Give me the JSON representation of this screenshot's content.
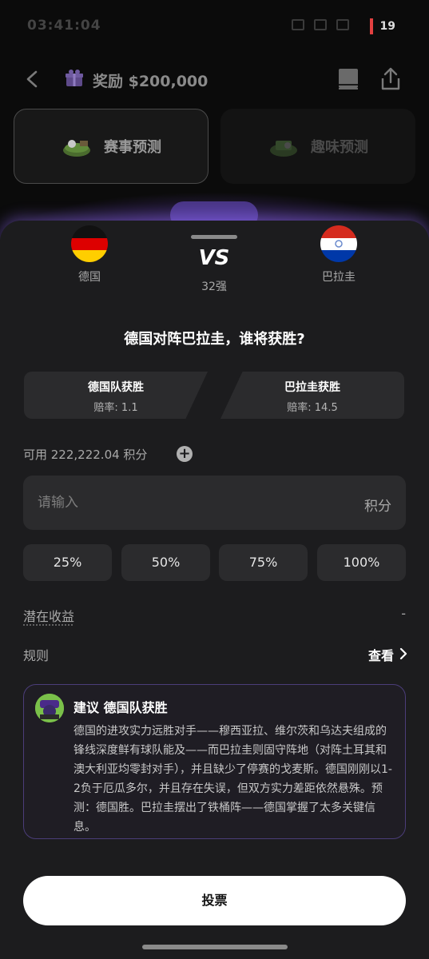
{
  "status_bar": {
    "time": "03:41:04",
    "battery": "19"
  },
  "header": {
    "title": "奖励 $200,000"
  },
  "mode_tabs": [
    {
      "label": "赛事预测",
      "active": true
    },
    {
      "label": "趣味预测",
      "active": false
    }
  ],
  "match": {
    "home": {
      "name": "德国",
      "flag": "germany-flag-icon"
    },
    "away": {
      "name": "巴拉圭",
      "flag": "paraguay-flag-icon"
    },
    "vs": "VS",
    "round": "32强",
    "question": "德国对阵巴拉圭，谁将获胜?"
  },
  "picks": [
    {
      "title": "德国队获胜",
      "odds": "赔率: 1.1"
    },
    {
      "title": "巴拉圭获胜",
      "odds": "赔率: 14.5"
    }
  ],
  "balance": {
    "label": "可用 222,222.04 积分"
  },
  "amount": {
    "placeholder": "请输入",
    "unit": "积分"
  },
  "percent_options": [
    "25%",
    "50%",
    "75%",
    "100%"
  ],
  "potential": {
    "label": "潜在收益",
    "value": "-"
  },
  "rules": {
    "label": "规则",
    "link": "查看"
  },
  "advice": {
    "title": "建议 德国队获胜",
    "body": "德国的进攻实力远胜对手——穆西亚拉、维尔茨和乌达夫组成的锋线深度鲜有球队能及——而巴拉圭则固守阵地（对阵土耳其和澳大利亚均零封对手），并且缺少了停赛的戈麦斯。德国刚刚以1-2负于厄瓜多尔，并且存在失误，但双方实力差距依然悬殊。预测：德国胜。巴拉圭摆出了铁桶阵——德国掌握了太多关键信息。"
  },
  "vote_button": {
    "label": "投票"
  },
  "colors": {
    "accent": "#8c5aff",
    "sheet_bg": "#1c1c1e",
    "card_bg": "#2b2b2d"
  }
}
